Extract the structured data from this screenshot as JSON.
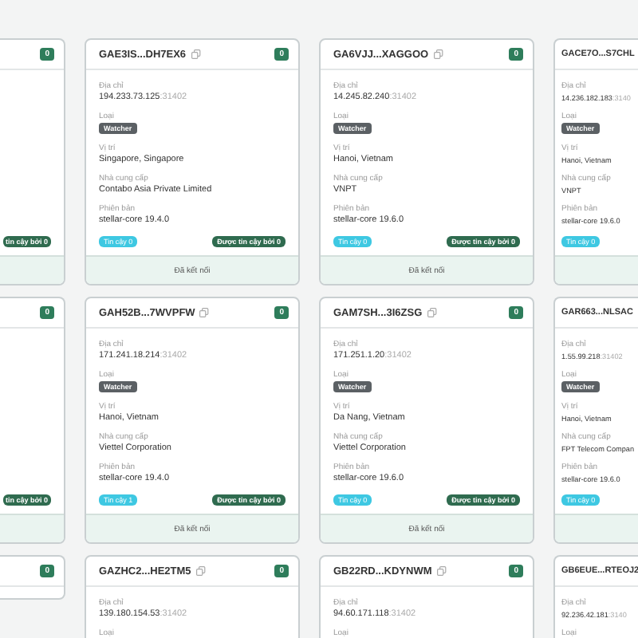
{
  "cards": [
    {
      "kind": "right",
      "badge": "0",
      "trusted_by": "tin cậy bởi 0"
    },
    {
      "kind": "full",
      "title": "GAE3IS...DH7EX6",
      "badge": "0",
      "fields": [
        {
          "kind": "address",
          "label": "Địa chỉ",
          "value": "194.233.73.125",
          "port": ":31402"
        },
        {
          "kind": "badge",
          "label": "Loại",
          "value": "Watcher"
        },
        {
          "kind": "text",
          "label": "Vị trí",
          "value": "Singapore, Singapore"
        },
        {
          "kind": "text",
          "label": "Nhà cung cấp",
          "value": "Contabo Asia Private Limited"
        },
        {
          "kind": "text",
          "label": "Phiên bản",
          "value": "stellar-core 19.4.0"
        }
      ],
      "trust": "Tin cậy 0",
      "trusted_by": "Được tin cậy bởi 0",
      "footer": "Đã kết nối"
    },
    {
      "kind": "full",
      "title": "GA6VJJ...XAGGOO",
      "badge": "0",
      "fields": [
        {
          "kind": "address",
          "label": "Địa chỉ",
          "value": "14.245.82.240",
          "port": ":31402"
        },
        {
          "kind": "badge",
          "label": "Loại",
          "value": "Watcher"
        },
        {
          "kind": "text",
          "label": "Vị trí",
          "value": "Hanoi, Vietnam"
        },
        {
          "kind": "text",
          "label": "Nhà cung cấp",
          "value": "VNPT"
        },
        {
          "kind": "text",
          "label": "Phiên bản",
          "value": "stellar-core 19.6.0"
        }
      ],
      "trust": "Tin cậy 0",
      "trusted_by": "Được tin cậy bởi 0",
      "footer": "Đã kết nối"
    },
    {
      "kind": "left",
      "title": "GACE7O...S7CHL",
      "fields": [
        {
          "kind": "address",
          "label": "Địa chỉ",
          "value": "14.236.182.183",
          "port": ":3140"
        },
        {
          "kind": "badge",
          "label": "Loại",
          "value": "Watcher"
        },
        {
          "kind": "text",
          "label": "Vị trí",
          "value": "Hanoi, Vietnam"
        },
        {
          "kind": "text",
          "label": "Nhà cung cấp",
          "value": "VNPT"
        },
        {
          "kind": "text",
          "label": "Phiên bản",
          "value": "stellar-core 19.6.0"
        }
      ],
      "trust": "Tin cậy 0"
    },
    {
      "kind": "right",
      "badge": "0",
      "trusted_by": "tin cậy bởi 0"
    },
    {
      "kind": "full",
      "title": "GAH52B...7WVPFW",
      "badge": "0",
      "fields": [
        {
          "kind": "address",
          "label": "Địa chỉ",
          "value": "171.241.18.214",
          "port": ":31402"
        },
        {
          "kind": "badge",
          "label": "Loại",
          "value": "Watcher"
        },
        {
          "kind": "text",
          "label": "Vị trí",
          "value": "Hanoi, Vietnam"
        },
        {
          "kind": "text",
          "label": "Nhà cung cấp",
          "value": "Viettel Corporation"
        },
        {
          "kind": "text",
          "label": "Phiên bản",
          "value": "stellar-core 19.4.0"
        }
      ],
      "trust": "Tin cậy 1",
      "trusted_by": "Được tin cậy bởi 0",
      "footer": "Đã kết nối"
    },
    {
      "kind": "full",
      "title": "GAM7SH...3I6ZSG",
      "badge": "0",
      "fields": [
        {
          "kind": "address",
          "label": "Địa chỉ",
          "value": "171.251.1.20",
          "port": ":31402"
        },
        {
          "kind": "badge",
          "label": "Loại",
          "value": "Watcher"
        },
        {
          "kind": "text",
          "label": "Vị trí",
          "value": "Da Nang, Vietnam"
        },
        {
          "kind": "text",
          "label": "Nhà cung cấp",
          "value": "Viettel Corporation"
        },
        {
          "kind": "text",
          "label": "Phiên bản",
          "value": "stellar-core 19.6.0"
        }
      ],
      "trust": "Tin cậy 0",
      "trusted_by": "Được tin cậy bởi 0",
      "footer": "Đã kết nối"
    },
    {
      "kind": "left",
      "title": "GAR663...NLSAC",
      "fields": [
        {
          "kind": "address",
          "label": "Địa chỉ",
          "value": "1.55.99.218",
          "port": ":31402"
        },
        {
          "kind": "badge",
          "label": "Loại",
          "value": "Watcher"
        },
        {
          "kind": "text",
          "label": "Vị trí",
          "value": "Hanoi, Vietnam"
        },
        {
          "kind": "text",
          "label": "Nhà cung cấp",
          "value": "FPT Telecom Compan"
        },
        {
          "kind": "text",
          "label": "Phiên bản",
          "value": "stellar-core 19.6.0"
        }
      ],
      "trust": "Tin cậy 0"
    },
    {
      "kind": "right",
      "badge": "0"
    },
    {
      "kind": "full",
      "title": "GAZHC2...HE2TM5",
      "badge": "0",
      "fields": [
        {
          "kind": "address",
          "label": "Địa chỉ",
          "value": "139.180.154.53",
          "port": ":31402"
        },
        {
          "kind": "label",
          "label": "Loại"
        }
      ]
    },
    {
      "kind": "full",
      "title": "GB22RD...KDYNWM",
      "badge": "0",
      "fields": [
        {
          "kind": "address",
          "label": "Địa chỉ",
          "value": "94.60.171.118",
          "port": ":31402"
        },
        {
          "kind": "label",
          "label": "Loại"
        }
      ]
    },
    {
      "kind": "left",
      "title": "GB6EUE...RTEOJ2",
      "fields": [
        {
          "kind": "address",
          "label": "Địa chỉ",
          "value": "92.236.42.181",
          "port": ":3140"
        },
        {
          "kind": "label",
          "label": "Loại"
        }
      ]
    }
  ]
}
